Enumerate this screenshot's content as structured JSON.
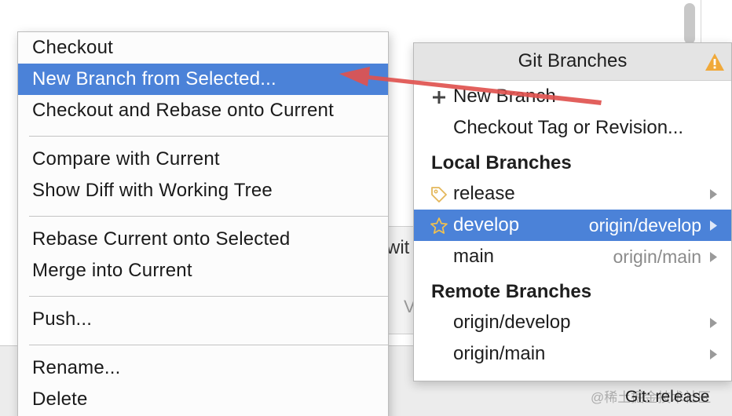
{
  "background": {
    "partial_text_1": "wit",
    "partial_text_2": "V"
  },
  "context_menu": {
    "groups": [
      [
        "Checkout",
        "New Branch from Selected...",
        "Checkout and Rebase onto Current"
      ],
      [
        "Compare with Current",
        "Show Diff with Working Tree"
      ],
      [
        "Rebase Current onto Selected",
        "Merge into Current"
      ],
      [
        "Push..."
      ],
      [
        "Rename...",
        "Delete"
      ]
    ],
    "selected": "New Branch from Selected..."
  },
  "git_branches": {
    "title": "Git Branches",
    "warning_icon": "warning-icon",
    "actions": {
      "new_branch": "New Branch",
      "checkout_tag": "Checkout Tag or Revision..."
    },
    "local_header": "Local Branches",
    "local": [
      {
        "name": "release",
        "tracking": "",
        "icon": "tag-icon"
      },
      {
        "name": "develop",
        "tracking": "origin/develop",
        "icon": "star-icon",
        "selected": true
      },
      {
        "name": "main",
        "tracking": "origin/main",
        "icon": ""
      }
    ],
    "remote_header": "Remote Branches",
    "remote": [
      {
        "name": "origin/develop"
      },
      {
        "name": "origin/main"
      }
    ]
  },
  "status_bar": {
    "git_status": "Git: release",
    "watermark": "@稀土掘金技术社区"
  },
  "colors": {
    "selection": "#4b82d8",
    "arrow": "#e0524f",
    "warning": "#f0a93a"
  }
}
